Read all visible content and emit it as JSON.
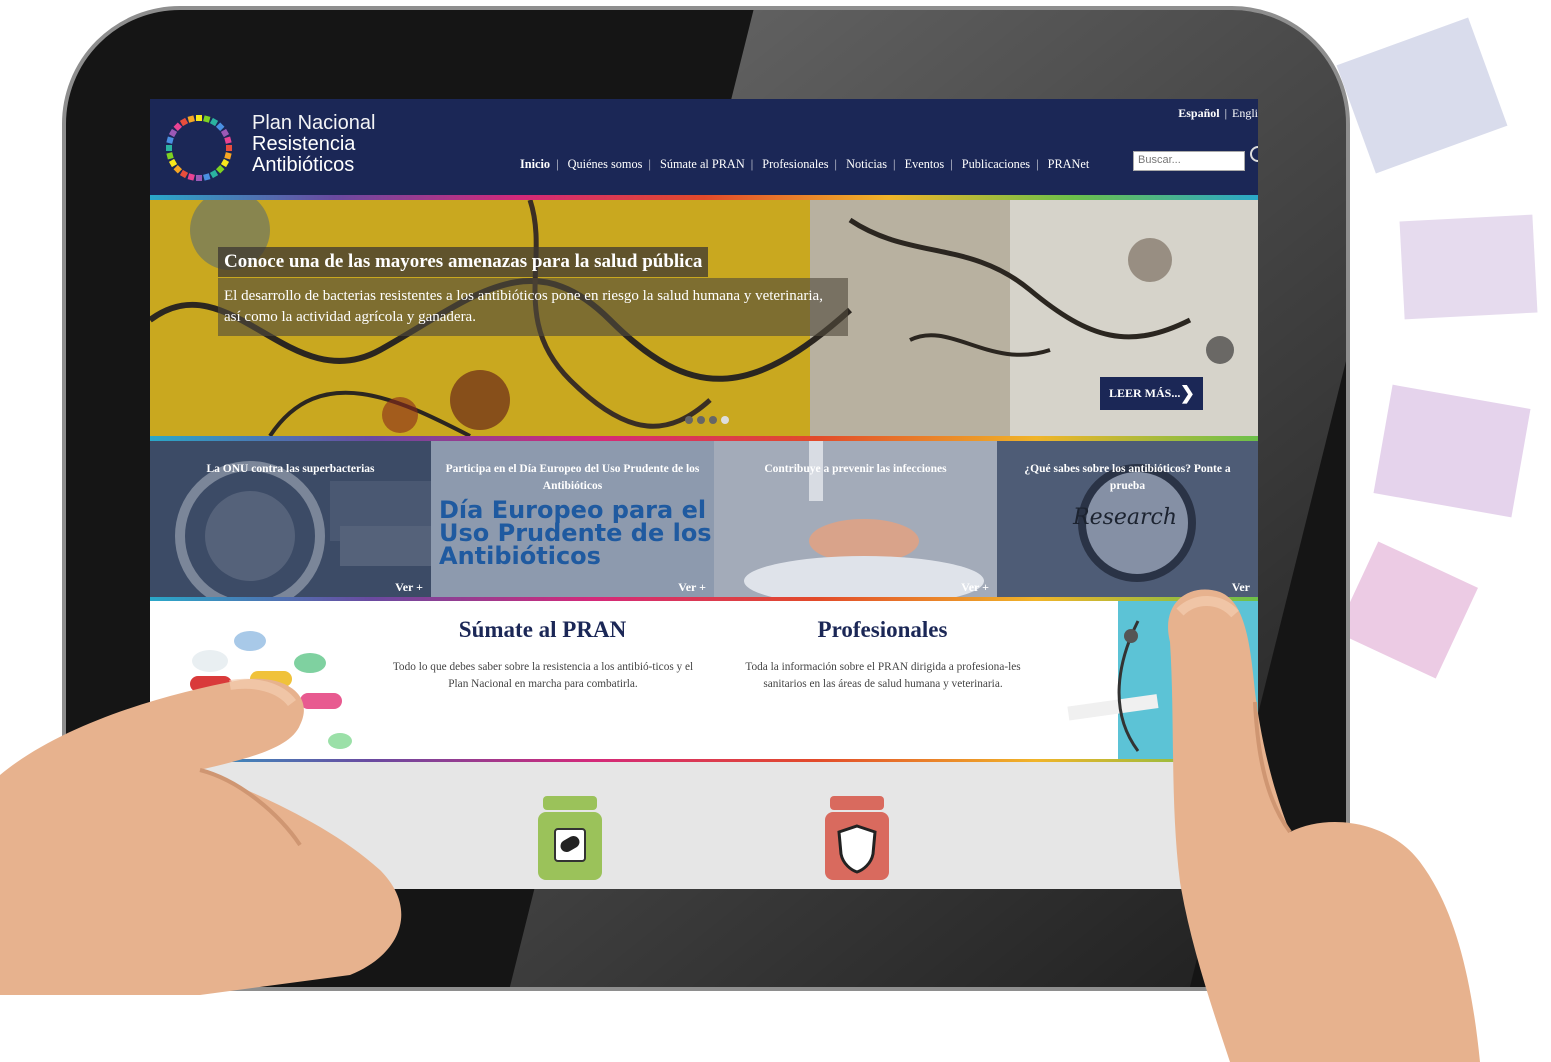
{
  "header": {
    "logo": {
      "line1": "Plan Nacional",
      "line2": "Resistencia",
      "line3": "Antibióticos"
    },
    "languages": {
      "active": "Español",
      "other": "Engli"
    },
    "nav": [
      "Inicio",
      "Quiénes somos",
      "Súmate al PRAN",
      "Profesionales",
      "Noticias",
      "Eventos",
      "Publicaciones",
      "PRANet"
    ],
    "search_placeholder": "Buscar..."
  },
  "hero": {
    "title": "Conoce una de las mayores amenazas para la salud pública",
    "text": "El desarrollo de bacterias resistentes a los antibióticos pone en riesgo la salud humana y veterinaria, así como la actividad agrícola y ganadera.",
    "button": "LEER MÁS...",
    "slides_total": 4,
    "slide_active": 4
  },
  "tiles": [
    {
      "title": "La ONU contra las superbacterias",
      "more": "Ver +",
      "image_text": ""
    },
    {
      "title": "Participa en el Día Europeo del Uso Prudente de los Antibióticos",
      "more": "Ver +",
      "image_text": "Día Europeo para el Uso Prudente de los Antibióticos"
    },
    {
      "title": "Contribuye a prevenir las infecciones",
      "more": "Ver +",
      "image_text": ""
    },
    {
      "title": "¿Qué sabes sobre los antibióticos? Ponte a prueba",
      "more": "Ver",
      "image_text": "Research"
    }
  ],
  "sections": [
    {
      "title": "Súmate al PRAN",
      "text": "Todo lo que debes saber sobre la resistencia a los antibió-ticos y el Plan Nacional en marcha para combatirla."
    },
    {
      "title": "Profesionales",
      "text": "Toda la información sobre el PRAN dirigida a profesiona-les sanitarios en las áreas de salud humana y veterinaria."
    }
  ],
  "icons": [
    "pills-jar-icon",
    "shield-jar-icon"
  ],
  "colors": {
    "navy": "#1b2756",
    "green_jar": "#9bc25a",
    "red_jar": "#d96a5e",
    "hero_yellow": "#c8a61c"
  }
}
